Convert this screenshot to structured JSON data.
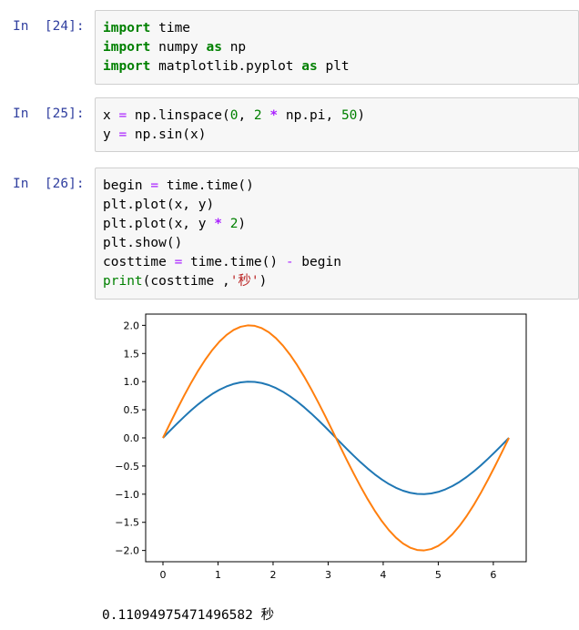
{
  "cells": [
    {
      "prompt": "In  [24]:",
      "lines": [
        [
          [
            "import",
            "kw"
          ],
          [
            " time",
            ""
          ]
        ],
        [
          [
            "import",
            "kw"
          ],
          [
            " numpy ",
            ""
          ],
          [
            "as",
            "kw"
          ],
          [
            " np",
            ""
          ]
        ],
        [
          [
            "import",
            "kw"
          ],
          [
            " matplotlib.pyplot ",
            ""
          ],
          [
            "as",
            "kw"
          ],
          [
            " plt",
            ""
          ]
        ]
      ]
    },
    {
      "prompt": "In  [25]:",
      "lines": [
        [
          [
            "x ",
            ""
          ],
          [
            "=",
            "op2"
          ],
          [
            " np.linspace(",
            ""
          ],
          [
            "0",
            "num"
          ],
          [
            ", ",
            ""
          ],
          [
            "2",
            "num"
          ],
          [
            " ",
            ""
          ],
          [
            "*",
            "op"
          ],
          [
            " np.pi, ",
            ""
          ],
          [
            "50",
            "num"
          ],
          [
            ")",
            ""
          ]
        ],
        [
          [
            "y ",
            ""
          ],
          [
            "=",
            "op2"
          ],
          [
            " np.sin(x)",
            ""
          ]
        ]
      ]
    },
    {
      "prompt": "In  [26]:",
      "lines": [
        [
          [
            "begin ",
            ""
          ],
          [
            "=",
            "op2"
          ],
          [
            " time.time()",
            ""
          ]
        ],
        [
          [
            "plt.plot(x, y)",
            ""
          ]
        ],
        [
          [
            "plt.plot(x, y ",
            ""
          ],
          [
            "*",
            "op"
          ],
          [
            " ",
            ""
          ],
          [
            "2",
            "num"
          ],
          [
            ")",
            ""
          ]
        ],
        [
          [
            "plt.show()",
            ""
          ]
        ],
        [
          [
            "costtime ",
            ""
          ],
          [
            "=",
            "op2"
          ],
          [
            " time.time() ",
            ""
          ],
          [
            "-",
            "op2"
          ],
          [
            " begin",
            ""
          ]
        ],
        [
          [
            "print",
            "bi"
          ],
          [
            "(costtime ,",
            ""
          ],
          [
            "'秒'",
            "str"
          ],
          [
            ")",
            ""
          ]
        ]
      ]
    }
  ],
  "output_text": "0.11094975471496582 秒",
  "chart_data": {
    "type": "line",
    "xlim": [
      -0.314,
      6.597
    ],
    "ylim": [
      -2.2,
      2.2
    ],
    "x_ticks": [
      0,
      1,
      2,
      3,
      4,
      5,
      6
    ],
    "y_ticks": [
      2.0,
      1.5,
      1.0,
      0.5,
      0.0,
      -0.5,
      -1.0,
      -1.5,
      -2.0
    ],
    "x_tick_labels": [
      "0",
      "1",
      "2",
      "3",
      "4",
      "5",
      "6"
    ],
    "y_tick_labels": [
      "2.0",
      "1.5",
      "1.0",
      "0.5",
      "0.0",
      "−0.5",
      "−1.0",
      "−1.5",
      "−2.0"
    ],
    "grid": false,
    "series": [
      {
        "color": "#1f77b4",
        "x": [
          0,
          0.1282,
          0.2565,
          0.3847,
          0.5129,
          0.6411,
          0.7694,
          0.8976,
          1.0258,
          1.1541,
          1.2823,
          1.4105,
          1.5387,
          1.667,
          1.7952,
          1.9234,
          2.0517,
          2.1799,
          2.3081,
          2.4363,
          2.5646,
          2.6928,
          2.821,
          2.9493,
          3.0775,
          3.2057,
          3.3339,
          3.4622,
          3.5904,
          3.7186,
          3.8468,
          3.9751,
          4.1033,
          4.2315,
          4.3598,
          4.488,
          4.6162,
          4.7444,
          4.8727,
          5.0009,
          5.1291,
          5.2574,
          5.3856,
          5.5138,
          5.642,
          5.7703,
          5.8985,
          6.0267,
          6.155,
          6.2832
        ],
        "values": [
          0,
          0.1279,
          0.2537,
          0.3753,
          0.4907,
          0.5981,
          0.6957,
          0.7818,
          0.8551,
          0.9144,
          0.9587,
          0.9872,
          0.9995,
          0.9954,
          0.9749,
          0.9383,
          0.8862,
          0.8195,
          0.7394,
          0.6473,
          0.5446,
          0.4333,
          0.315,
          0.1918,
          0.0641,
          -0.0641,
          -0.1918,
          -0.315,
          -0.4333,
          -0.5446,
          -0.6473,
          -0.7394,
          -0.8195,
          -0.8862,
          -0.9383,
          -0.9749,
          -0.9954,
          -0.9995,
          -0.9872,
          -0.9587,
          -0.9144,
          -0.8551,
          -0.7818,
          -0.6957,
          -0.5981,
          -0.4907,
          -0.3753,
          -0.2537,
          -0.1279,
          0
        ]
      },
      {
        "color": "#ff7f0e",
        "x": [
          0,
          0.1282,
          0.2565,
          0.3847,
          0.5129,
          0.6411,
          0.7694,
          0.8976,
          1.0258,
          1.1541,
          1.2823,
          1.4105,
          1.5387,
          1.667,
          1.7952,
          1.9234,
          2.0517,
          2.1799,
          2.3081,
          2.4363,
          2.5646,
          2.6928,
          2.821,
          2.9493,
          3.0775,
          3.2057,
          3.3339,
          3.4622,
          3.5904,
          3.7186,
          3.8468,
          3.9751,
          4.1033,
          4.2315,
          4.3598,
          4.488,
          4.6162,
          4.7444,
          4.8727,
          5.0009,
          5.1291,
          5.2574,
          5.3856,
          5.5138,
          5.642,
          5.7703,
          5.8985,
          6.0267,
          6.155,
          6.2832
        ],
        "values": [
          0,
          0.2558,
          0.5074,
          0.7506,
          0.9814,
          1.1962,
          1.3914,
          1.5636,
          1.7102,
          1.8288,
          1.9174,
          1.9744,
          1.999,
          1.9908,
          1.9498,
          1.8766,
          1.7724,
          1.639,
          1.4788,
          1.2946,
          1.0892,
          0.8666,
          0.63,
          0.3836,
          0.1282,
          -0.1282,
          -0.3836,
          -0.63,
          -0.8666,
          -1.0892,
          -1.2946,
          -1.4788,
          -1.639,
          -1.7724,
          -1.8766,
          -1.9498,
          -1.9908,
          -1.999,
          -1.9744,
          -1.9174,
          -1.8288,
          -1.7102,
          -1.5636,
          -1.3914,
          -1.1962,
          -0.9814,
          -0.7506,
          -0.5074,
          -0.2558,
          0
        ]
      }
    ]
  }
}
